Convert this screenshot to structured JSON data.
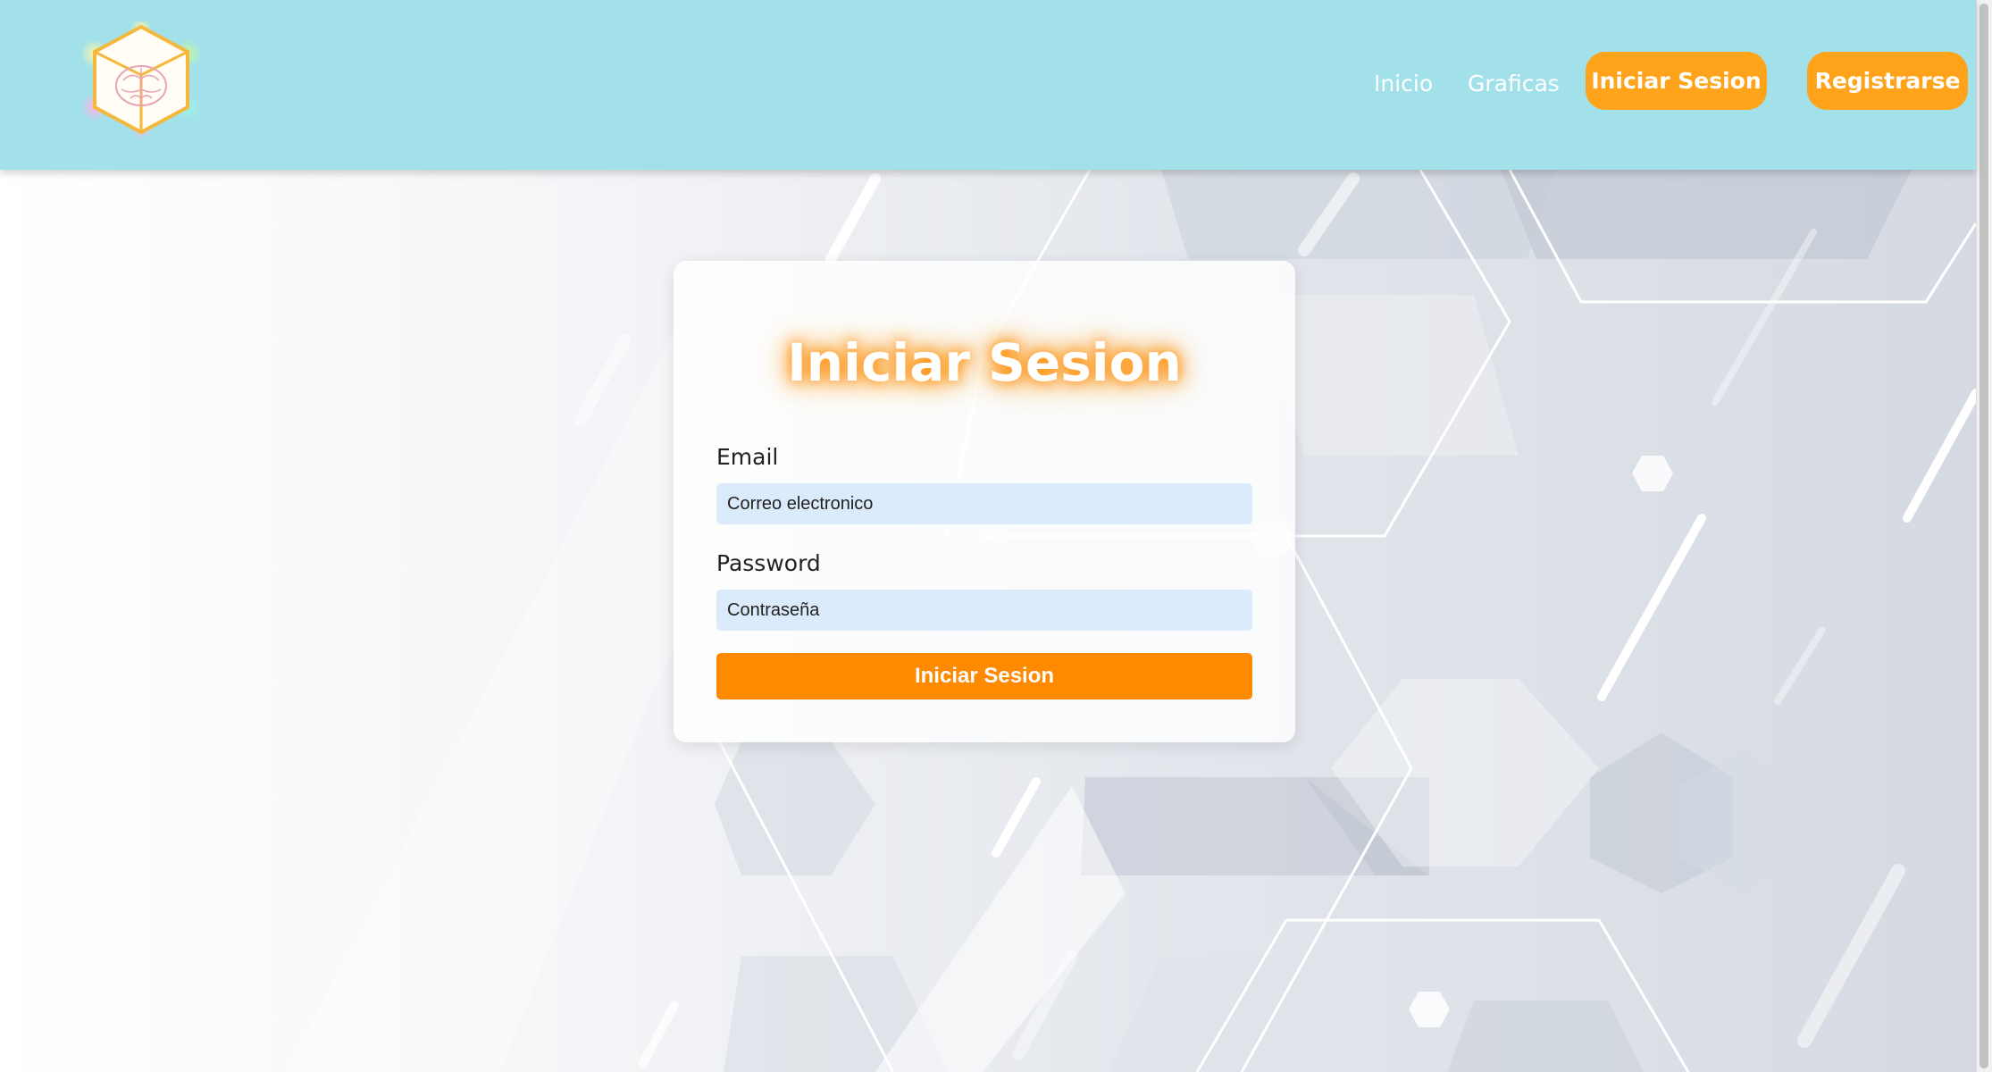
{
  "nav": {
    "links": [
      "Inicio",
      "Graficas"
    ],
    "buttons": [
      "Iniciar Sesion",
      "Registrarse"
    ]
  },
  "login": {
    "title": "Iniciar Sesion",
    "email_label": "Email",
    "email_value": "Correo electronico",
    "password_label": "Password",
    "password_value": "Contraseña",
    "submit_label": "Iniciar Sesion"
  },
  "colors": {
    "header": "#a2e1ea",
    "accent": "#ffa31a",
    "submit": "#ff8a00",
    "input": "#dcebfb"
  },
  "icons": {
    "logo": "brain-cube-logo"
  }
}
